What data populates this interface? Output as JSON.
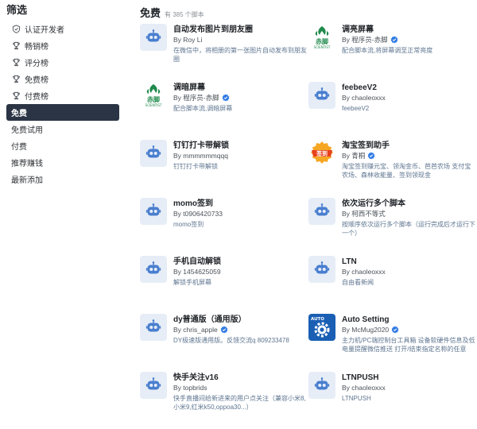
{
  "sidebar": {
    "title": "筛选",
    "items": [
      {
        "label": "认证开发者",
        "icon": "shield-check-icon"
      },
      {
        "label": "畅销榜",
        "icon": "trophy-icon"
      },
      {
        "label": "评分榜",
        "icon": "trophy-icon"
      },
      {
        "label": "免费榜",
        "icon": "trophy-icon"
      },
      {
        "label": "付费榜",
        "icon": "trophy-icon"
      },
      {
        "label": "免费",
        "active": true
      },
      {
        "label": "免费试用"
      },
      {
        "label": "付费"
      },
      {
        "label": "推荐赚钱"
      },
      {
        "label": "最新添加"
      }
    ]
  },
  "main": {
    "title": "免费",
    "count": "有 385 个脚本"
  },
  "cards": [
    {
      "title": "自动发布图片到朋友圈",
      "author": "By Roy Li",
      "verified": false,
      "desc": "在微信中，将相册的第一张图片自动发布到朋友圈",
      "icon": "robot-icon"
    },
    {
      "title": "调亮屏幕",
      "author": "By 程序员-赤脚",
      "verified": true,
      "desc": "配合脚本流,将屏幕调至正常亮度",
      "icon": "chijiao-scientist-logo"
    },
    {
      "title": "调暗屏幕",
      "author": "By 程序员-赤脚",
      "verified": true,
      "desc": "配合脚本流,调暗屏幕",
      "icon": "chijiao-scientist-logo"
    },
    {
      "title": "feebeeV2",
      "author": "By chaoleoxxx",
      "verified": false,
      "desc": "feebeeV2",
      "icon": "robot-icon"
    },
    {
      "title": "钉钉打卡带解锁",
      "author": "By mmmmmmqqq",
      "verified": false,
      "desc": "钉钉打卡带解锁",
      "icon": "robot-icon"
    },
    {
      "title": "淘宝签到助手",
      "author": "By 青桐",
      "verified": true,
      "desc": "淘宝签到赚元宝、领淘金币、芭芭农场 支付宝农场、森林收能量、签到领现金",
      "icon": "checkin-badge-icon",
      "badge_text": "签到"
    },
    {
      "title": "momo签到",
      "author": "By t0906420733",
      "verified": false,
      "desc": "momo签到",
      "icon": "robot-icon"
    },
    {
      "title": "依次运行多个脚本",
      "author": "By 柯西不等式",
      "verified": false,
      "desc": "按顺序依次运行多个脚本（运行完成后才运行下一个）",
      "icon": "robot-icon"
    },
    {
      "title": "手机自动解锁",
      "author": "By 1454625059",
      "verified": false,
      "desc": "解锁手机屏幕",
      "icon": "robot-icon"
    },
    {
      "title": "LTN",
      "author": "By chaoleoxxx",
      "verified": false,
      "desc": "自由看新闻",
      "icon": "robot-icon"
    },
    {
      "title": "dy普通版（通用版）",
      "author": "By chris_apple",
      "verified": true,
      "desc": "DY极速版通用版。反馈交流q 809233478",
      "icon": "robot-icon"
    },
    {
      "title": "Auto Setting",
      "author": "By McMug2020",
      "verified": true,
      "desc": "主力机/PC端控制台工具箱 设备软硬件信息及低电量提醒微信推送 打开/结束指定名称的任意APP 等",
      "icon": "auto-setting-gear-icon",
      "badge_text": "AUTO"
    },
    {
      "title": "快手关注v16",
      "author": "By topbrids",
      "verified": false,
      "desc": "快手直播间给新进来的用户点关注（兼容小米8,小米9,红米k50,oppoa30...）",
      "icon": "robot-icon"
    },
    {
      "title": "LTNPUSH",
      "author": "By chaoleoxxx",
      "verified": false,
      "desc": "LTNPUSH",
      "icon": "robot-icon"
    }
  ],
  "logo_text": {
    "chijiao": "赤脚",
    "scientist": "SCIENTIST"
  },
  "colors": {
    "sidebar_active_bg": "#2a3444",
    "robot_thumb_bg": "#e6edf7",
    "robot_icon": "#4a7fcf",
    "verified_blue": "#2f7ae5",
    "desc_text": "#5e7590",
    "logo_green": "#1f8a4c"
  }
}
